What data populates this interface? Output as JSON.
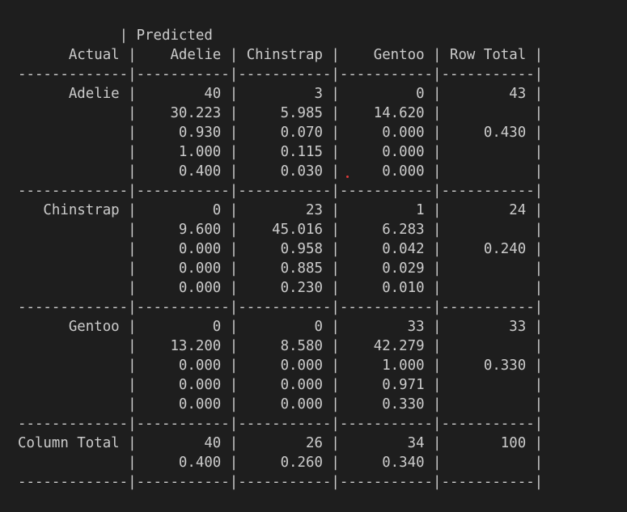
{
  "terminal": {
    "lines": [
      "            | Predicted",
      "      Actual |    Adelie | Chinstrap |    Gentoo | Row Total |",
      "-------------|-----------|-----------|-----------|-----------|",
      "      Adelie |        40 |         3 |         0 |        43 |",
      "             |    30.223 |     5.985 |    14.620 |           |",
      "             |     0.930 |     0.070 |     0.000 |     0.430 |",
      "             |     1.000 |     0.115 |     0.000 |           |",
      "             |     0.400 |     0.030 |     0.000 |           |",
      "-------------|-----------|-----------|-----------|-----------|",
      "   Chinstrap |         0 |        23 |         1 |        24 |",
      "             |     9.600 |    45.016 |     6.283 |           |",
      "             |     0.000 |     0.958 |     0.042 |     0.240 |",
      "             |     0.000 |     0.885 |     0.029 |           |",
      "             |     0.000 |     0.230 |     0.010 |           |",
      "-------------|-----------|-----------|-----------|-----------|",
      "      Gentoo |         0 |         0 |        33 |        33 |",
      "             |    13.200 |     8.580 |    42.279 |           |",
      "             |     0.000 |     0.000 |     1.000 |     0.330 |",
      "             |     0.000 |     0.000 |     0.971 |           |",
      "             |     0.000 |     0.000 |     0.330 |           |",
      "-------------|-----------|-----------|-----------|-----------|",
      "Column Total |        40 |        26 |        34 |       100 |",
      "             |     0.400 |     0.260 |     0.340 |           |",
      "-------------|-----------|-----------|-----------|-----------|"
    ]
  },
  "colors": {
    "background": "#1e1e1e",
    "text": "#cccccc",
    "cursor_dot": "#e03a3a"
  }
}
